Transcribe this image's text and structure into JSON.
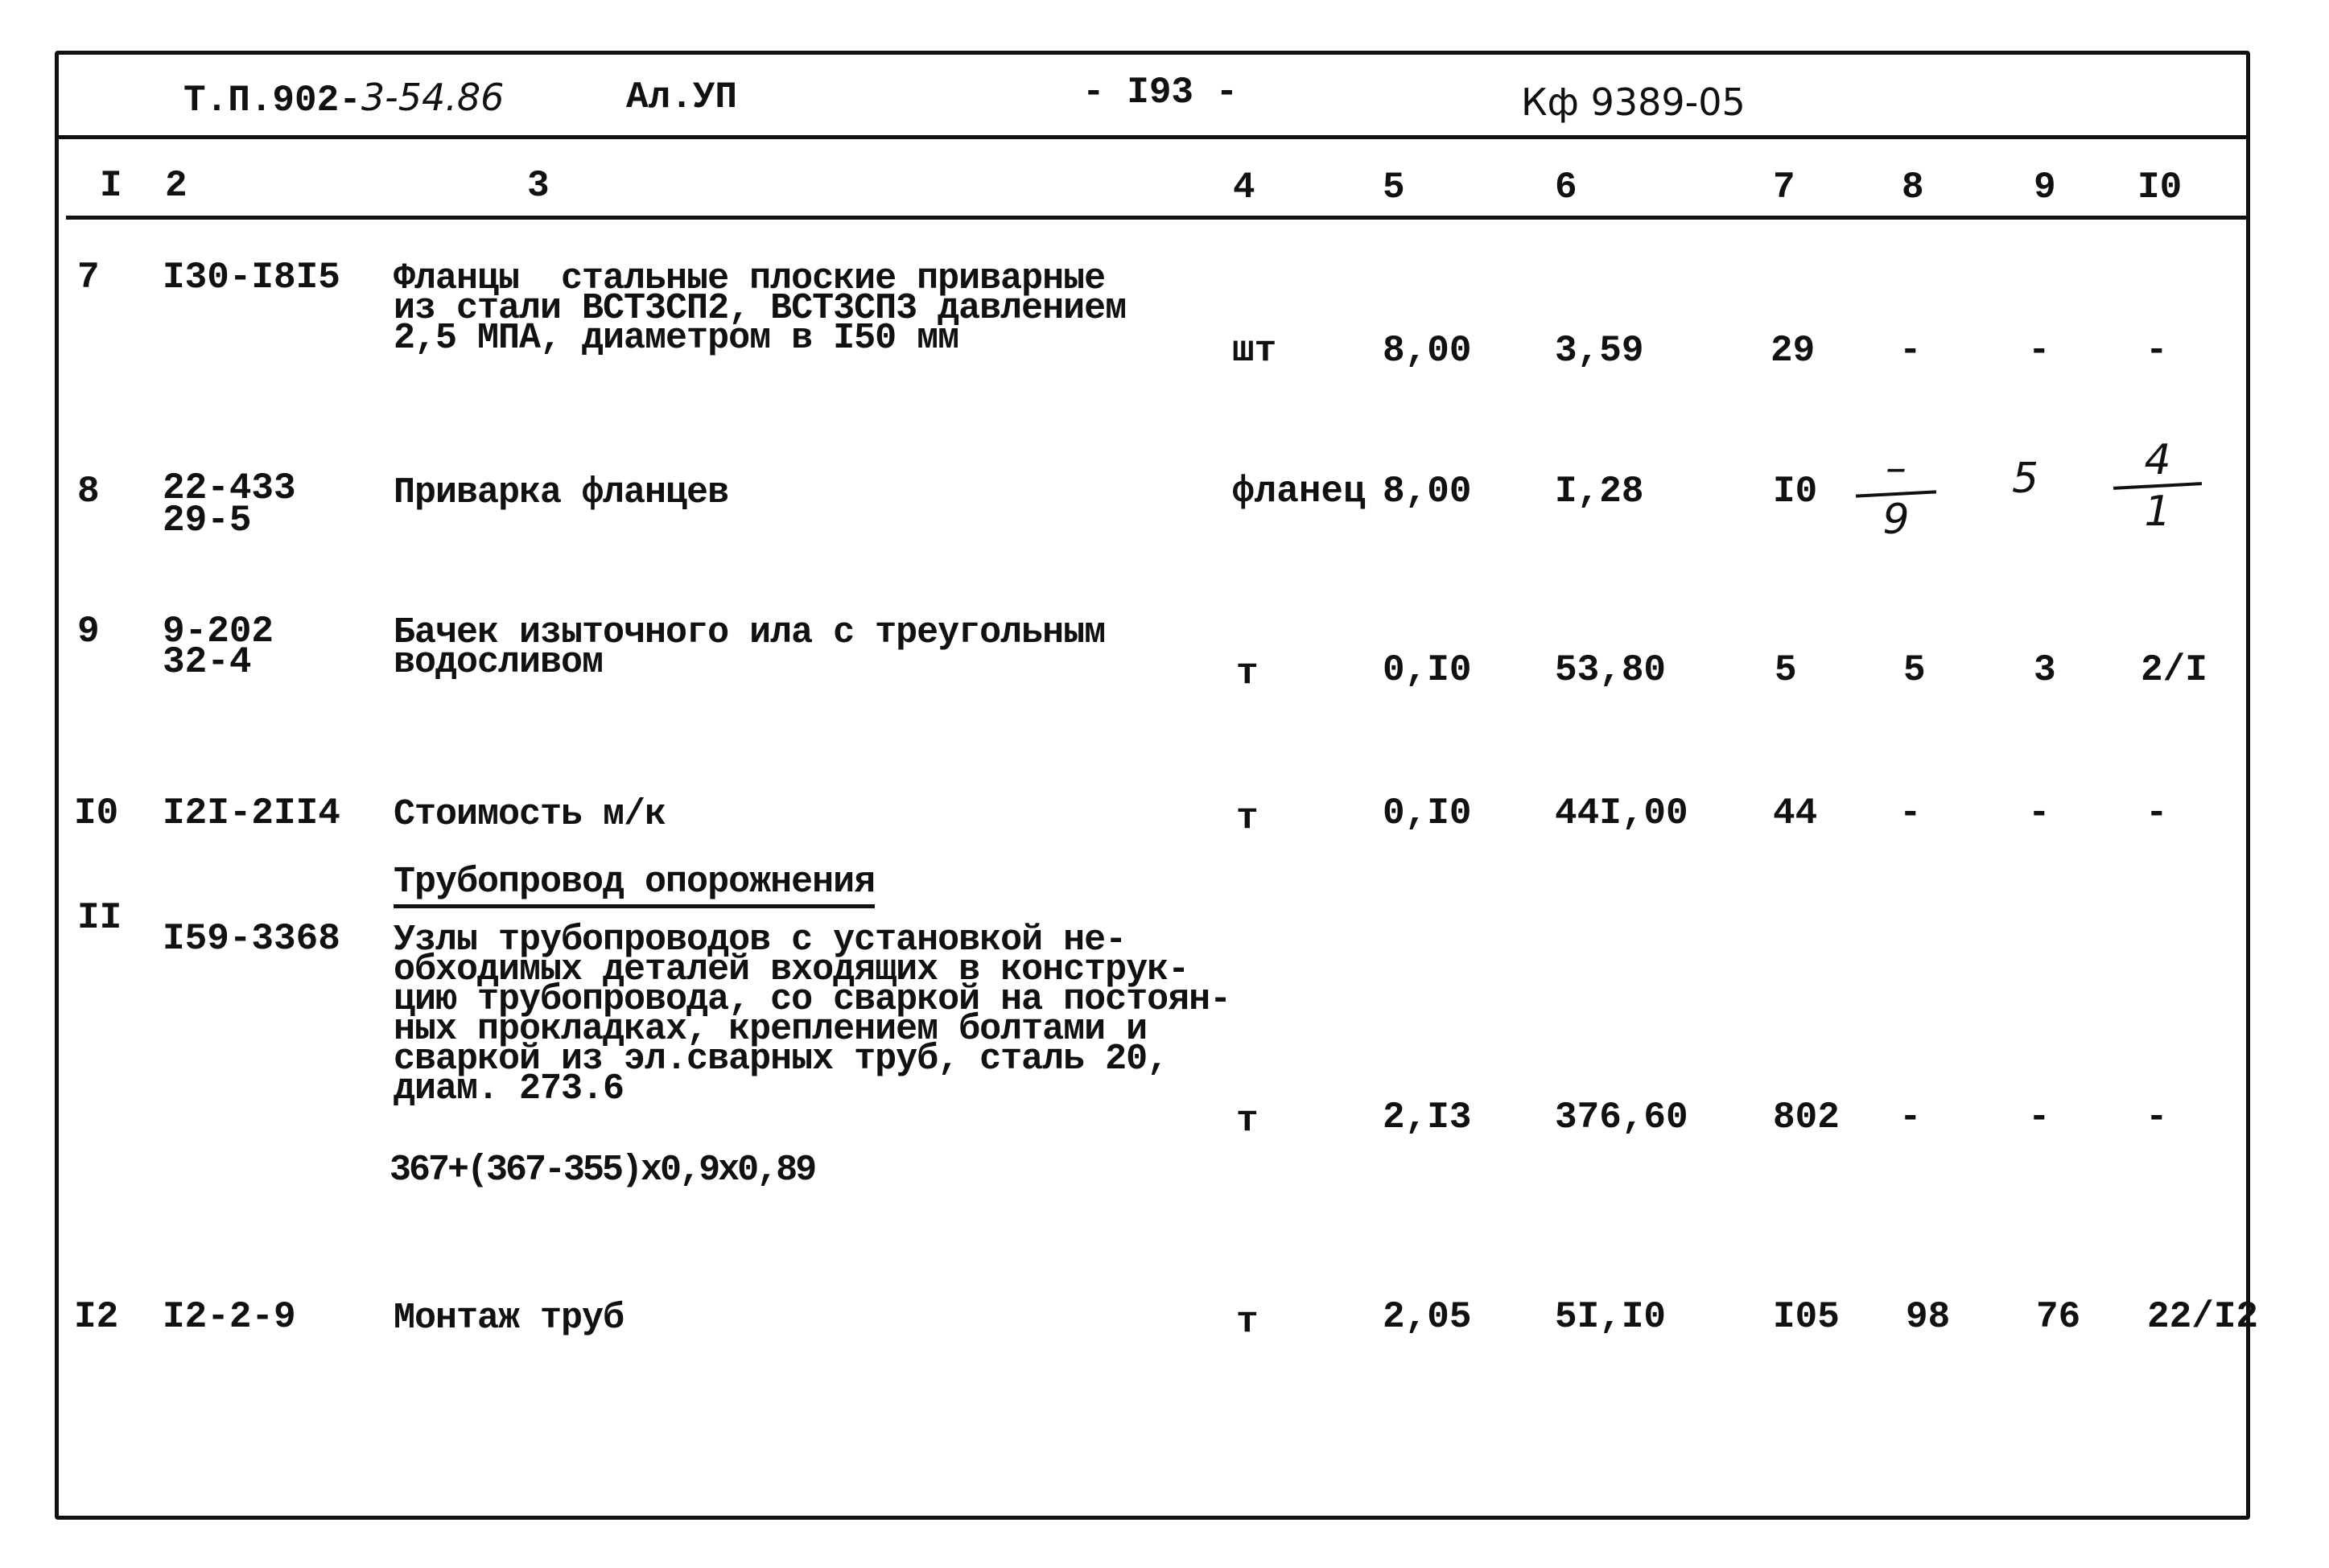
{
  "header": {
    "doc_code_printed": "Т.П.902-",
    "doc_code_handwritten": "3-54.86",
    "album": "Ал.УП",
    "page": "- I93 -",
    "stamp": "Кф 9389-05"
  },
  "columns": [
    "I",
    "2",
    "3",
    "4",
    "5",
    "6",
    "7",
    "8",
    "9",
    "I0"
  ],
  "rows": [
    {
      "num": "7",
      "code": [
        "I30-I8I5"
      ],
      "description": [
        "Фланцы  стальные плоские приварные",
        "из стали ВСТ3СП2, ВСТ3СП3 давлением",
        "2,5 МПА, диаметром в I50 мм"
      ],
      "unit": "шт",
      "qty": "8,00",
      "price": "3,59",
      "total": "29",
      "c8": "-",
      "c9": "-",
      "c10": "-"
    },
    {
      "num": "8",
      "code": [
        "22-433",
        "29-5"
      ],
      "description": [
        "Приварка фланцев"
      ],
      "unit": "фланец",
      "qty": "8,00",
      "price": "I,28",
      "total": "I0",
      "c8": {
        "top": "–",
        "bottom": "9"
      },
      "c9": "5",
      "c10": {
        "top": "4",
        "bottom": "1"
      }
    },
    {
      "num": "9",
      "code": [
        "9-202",
        "32-4"
      ],
      "description": [
        "Бачек изыточного ила с треугольным",
        "водосливом"
      ],
      "unit": "т",
      "qty": "0,I0",
      "price": "53,80",
      "total": "5",
      "c8": "5",
      "c9": "3",
      "c10": "2/I"
    },
    {
      "num": "I0",
      "code": [
        "I2I-2II4"
      ],
      "description": [
        "Стоимость м/к"
      ],
      "unit": "т",
      "qty": "0,I0",
      "price": "44I,00",
      "total": "44",
      "c8": "-",
      "c9": "-",
      "c10": "-"
    },
    {
      "num": "II",
      "section_title": "Трубопровод опорожнения",
      "code": [
        "I59-3368"
      ],
      "description": [
        "Узлы трубопроводов с установкой не-",
        "обходимых деталей входящих в конструк-",
        "цию трубопровода, со сваркой на постоян-",
        "ных прокладках, креплением болтами и",
        "сваркой из эл.сварных труб, сталь 20,",
        "диам. 273.6"
      ],
      "formula": "367+(367-355)x0,9x0,89",
      "unit": "т",
      "qty": "2,I3",
      "price": "376,60",
      "total": "802",
      "c8": "-",
      "c9": "-",
      "c10": "-"
    },
    {
      "num": "I2",
      "code": [
        "I2-2-9"
      ],
      "description": [
        "Монтаж труб"
      ],
      "unit": "т",
      "qty": "2,05",
      "price": "5I,I0",
      "total": "I05",
      "c8": "98",
      "c9": "76",
      "c10": "22/I2"
    }
  ]
}
